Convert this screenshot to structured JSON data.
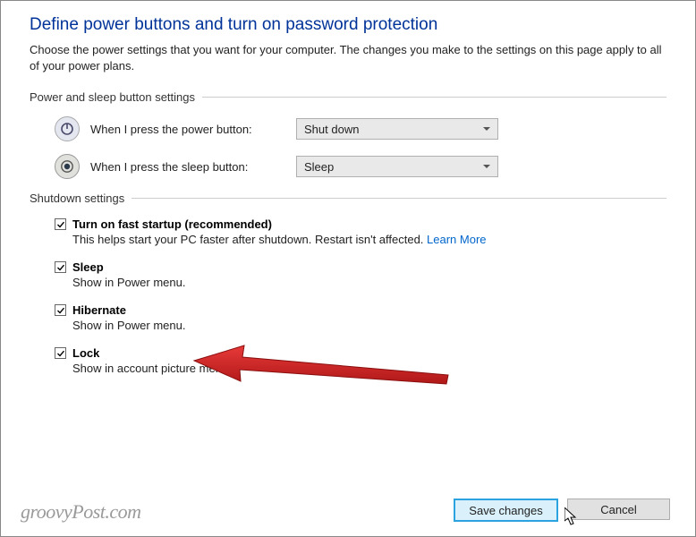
{
  "title": "Define power buttons and turn on password protection",
  "description": "Choose the power settings that you want for your computer. The changes you make to the settings on this page apply to all of your power plans.",
  "section1": {
    "header": "Power and sleep button settings"
  },
  "power_row": {
    "label": "When I press the power button:",
    "value": "Shut down"
  },
  "sleep_row": {
    "label": "When I press the sleep button:",
    "value": "Sleep"
  },
  "section2": {
    "header": "Shutdown settings"
  },
  "opt_fast": {
    "label": "Turn on fast startup (recommended)",
    "sub": "This helps start your PC faster after shutdown. Restart isn't affected. ",
    "learn": "Learn More",
    "checked": true
  },
  "opt_sleep": {
    "label": "Sleep",
    "sub": "Show in Power menu.",
    "checked": true
  },
  "opt_hibernate": {
    "label": "Hibernate",
    "sub": "Show in Power menu.",
    "checked": true
  },
  "opt_lock": {
    "label": "Lock",
    "sub": "Show in account picture menu.",
    "checked": true
  },
  "buttons": {
    "save": "Save changes",
    "cancel": "Cancel"
  },
  "watermark": "groovyPost.com"
}
